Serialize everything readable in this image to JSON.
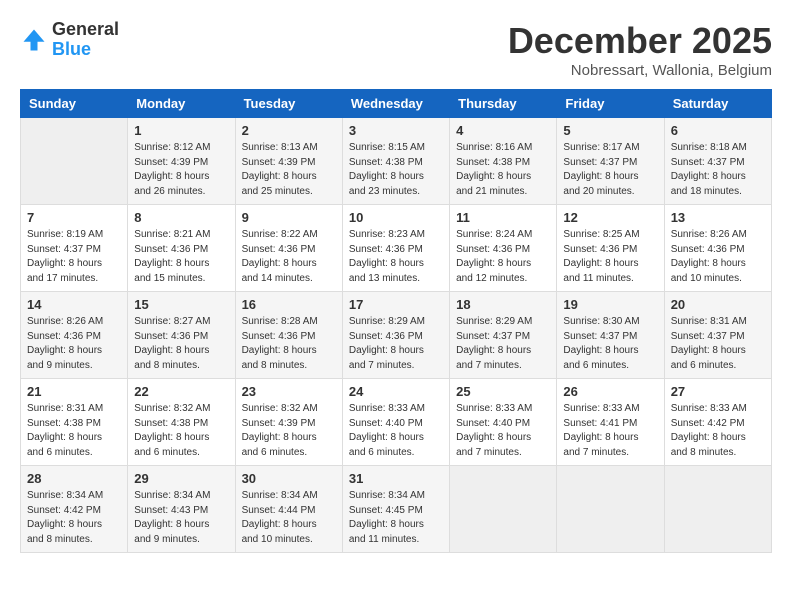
{
  "header": {
    "logo_line1": "General",
    "logo_line2": "Blue",
    "month": "December 2025",
    "location": "Nobressart, Wallonia, Belgium"
  },
  "weekdays": [
    "Sunday",
    "Monday",
    "Tuesday",
    "Wednesday",
    "Thursday",
    "Friday",
    "Saturday"
  ],
  "weeks": [
    [
      {
        "day": null
      },
      {
        "day": "1",
        "sunrise": "8:12 AM",
        "sunset": "4:39 PM",
        "daylight": "8 hours and 26 minutes."
      },
      {
        "day": "2",
        "sunrise": "8:13 AM",
        "sunset": "4:39 PM",
        "daylight": "8 hours and 25 minutes."
      },
      {
        "day": "3",
        "sunrise": "8:15 AM",
        "sunset": "4:38 PM",
        "daylight": "8 hours and 23 minutes."
      },
      {
        "day": "4",
        "sunrise": "8:16 AM",
        "sunset": "4:38 PM",
        "daylight": "8 hours and 21 minutes."
      },
      {
        "day": "5",
        "sunrise": "8:17 AM",
        "sunset": "4:37 PM",
        "daylight": "8 hours and 20 minutes."
      },
      {
        "day": "6",
        "sunrise": "8:18 AM",
        "sunset": "4:37 PM",
        "daylight": "8 hours and 18 minutes."
      }
    ],
    [
      {
        "day": "7",
        "sunrise": "8:19 AM",
        "sunset": "4:37 PM",
        "daylight": "8 hours and 17 minutes."
      },
      {
        "day": "8",
        "sunrise": "8:21 AM",
        "sunset": "4:36 PM",
        "daylight": "8 hours and 15 minutes."
      },
      {
        "day": "9",
        "sunrise": "8:22 AM",
        "sunset": "4:36 PM",
        "daylight": "8 hours and 14 minutes."
      },
      {
        "day": "10",
        "sunrise": "8:23 AM",
        "sunset": "4:36 PM",
        "daylight": "8 hours and 13 minutes."
      },
      {
        "day": "11",
        "sunrise": "8:24 AM",
        "sunset": "4:36 PM",
        "daylight": "8 hours and 12 minutes."
      },
      {
        "day": "12",
        "sunrise": "8:25 AM",
        "sunset": "4:36 PM",
        "daylight": "8 hours and 11 minutes."
      },
      {
        "day": "13",
        "sunrise": "8:26 AM",
        "sunset": "4:36 PM",
        "daylight": "8 hours and 10 minutes."
      }
    ],
    [
      {
        "day": "14",
        "sunrise": "8:26 AM",
        "sunset": "4:36 PM",
        "daylight": "8 hours and 9 minutes."
      },
      {
        "day": "15",
        "sunrise": "8:27 AM",
        "sunset": "4:36 PM",
        "daylight": "8 hours and 8 minutes."
      },
      {
        "day": "16",
        "sunrise": "8:28 AM",
        "sunset": "4:36 PM",
        "daylight": "8 hours and 8 minutes."
      },
      {
        "day": "17",
        "sunrise": "8:29 AM",
        "sunset": "4:36 PM",
        "daylight": "8 hours and 7 minutes."
      },
      {
        "day": "18",
        "sunrise": "8:29 AM",
        "sunset": "4:37 PM",
        "daylight": "8 hours and 7 minutes."
      },
      {
        "day": "19",
        "sunrise": "8:30 AM",
        "sunset": "4:37 PM",
        "daylight": "8 hours and 6 minutes."
      },
      {
        "day": "20",
        "sunrise": "8:31 AM",
        "sunset": "4:37 PM",
        "daylight": "8 hours and 6 minutes."
      }
    ],
    [
      {
        "day": "21",
        "sunrise": "8:31 AM",
        "sunset": "4:38 PM",
        "daylight": "8 hours and 6 minutes."
      },
      {
        "day": "22",
        "sunrise": "8:32 AM",
        "sunset": "4:38 PM",
        "daylight": "8 hours and 6 minutes."
      },
      {
        "day": "23",
        "sunrise": "8:32 AM",
        "sunset": "4:39 PM",
        "daylight": "8 hours and 6 minutes."
      },
      {
        "day": "24",
        "sunrise": "8:33 AM",
        "sunset": "4:40 PM",
        "daylight": "8 hours and 6 minutes."
      },
      {
        "day": "25",
        "sunrise": "8:33 AM",
        "sunset": "4:40 PM",
        "daylight": "8 hours and 7 minutes."
      },
      {
        "day": "26",
        "sunrise": "8:33 AM",
        "sunset": "4:41 PM",
        "daylight": "8 hours and 7 minutes."
      },
      {
        "day": "27",
        "sunrise": "8:33 AM",
        "sunset": "4:42 PM",
        "daylight": "8 hours and 8 minutes."
      }
    ],
    [
      {
        "day": "28",
        "sunrise": "8:34 AM",
        "sunset": "4:42 PM",
        "daylight": "8 hours and 8 minutes."
      },
      {
        "day": "29",
        "sunrise": "8:34 AM",
        "sunset": "4:43 PM",
        "daylight": "8 hours and 9 minutes."
      },
      {
        "day": "30",
        "sunrise": "8:34 AM",
        "sunset": "4:44 PM",
        "daylight": "8 hours and 10 minutes."
      },
      {
        "day": "31",
        "sunrise": "8:34 AM",
        "sunset": "4:45 PM",
        "daylight": "8 hours and 11 minutes."
      },
      {
        "day": null
      },
      {
        "day": null
      },
      {
        "day": null
      }
    ]
  ]
}
